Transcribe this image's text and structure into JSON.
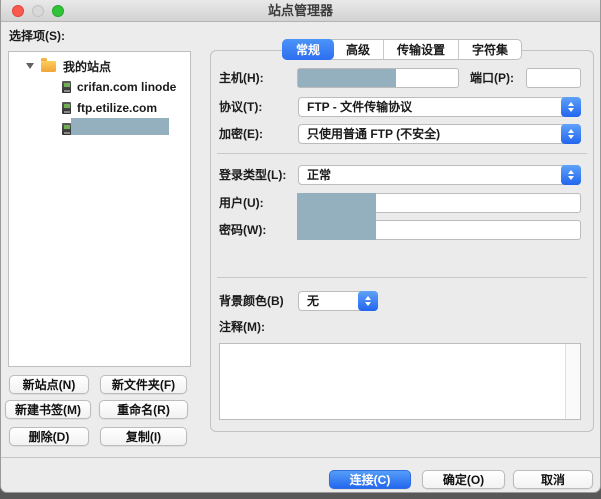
{
  "window": {
    "title": "站点管理器"
  },
  "colors": {
    "accent": "#3b7ff2",
    "redaction": "#94b0bf",
    "selection": "#94b0bf",
    "folder": "#f0a83c"
  },
  "sidebar": {
    "select_label": "选择项(S):",
    "tree": {
      "root_label": "我的站点",
      "items": [
        {
          "label": "crifan.com linode",
          "redacted": false
        },
        {
          "label": "ftp.etilize.com",
          "redacted": false
        },
        {
          "label": "",
          "redacted": true
        }
      ]
    },
    "buttons": {
      "new_site": "新站点(N)",
      "new_folder": "新文件夹(F)",
      "new_bookmark": "新建书签(M)",
      "rename": "重命名(R)",
      "delete": "删除(D)",
      "duplicate": "复制(I)"
    }
  },
  "tabs": {
    "general": "常规",
    "advanced": "高级",
    "transfer": "传输设置",
    "charset": "字符集",
    "selected": "常规"
  },
  "form": {
    "host_label": "主机(H):",
    "host_value": "",
    "port_label": "端口(P):",
    "port_value": "",
    "protocol_label": "协议(T):",
    "protocol_value": "FTP - 文件传输协议",
    "encryption_label": "加密(E):",
    "encryption_value": "只使用普通 FTP (不安全)",
    "logon_type_label": "登录类型(L):",
    "logon_type_value": "正常",
    "user_label": "用户(U):",
    "user_value": "",
    "password_label": "密码(W):",
    "password_value": "",
    "background_color_label": "背景颜色(B)",
    "background_color_value": "无",
    "comments_label": "注释(M):",
    "comments_value": ""
  },
  "footer": {
    "connect": "连接(C)",
    "ok": "确定(O)",
    "cancel": "取消"
  }
}
